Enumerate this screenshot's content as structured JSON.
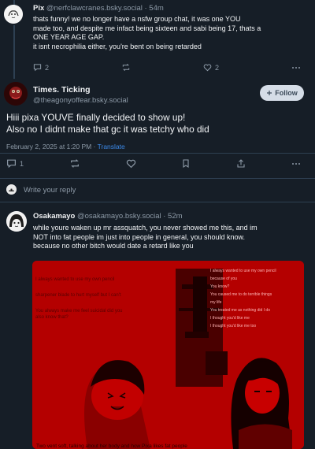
{
  "posts": {
    "pix": {
      "display_name": "Pix",
      "handle": "@nerfclawcranes.bsky.social",
      "time": "· 54m",
      "text_lines": [
        "thats funny! we no longer have a nsfw group chat, it was one YOU",
        "made too, and despite me infact being sixteen and sabi being 17, thats a",
        "ONE YEAR AGE GAP.",
        "it isnt necrophilia either, you're bent on being retarded"
      ],
      "reply_count": "2",
      "like_count": "2"
    },
    "times": {
      "display_name": "Times. Ticking",
      "handle": "@theagonyoffear.bsky.social",
      "follow_label": "Follow",
      "text_lines": [
        "Hiii pixa YOUVE finally decided to show up!",
        "Also no I didnt make that gc it was tetchy who did"
      ],
      "date": "February 2, 2025 at 1:20 PM",
      "translate_label": "Translate",
      "reply_count": "1"
    },
    "osakamayo": {
      "display_name": "Osakamayo",
      "handle": "@osakamayo.bsky.social",
      "time": "· 52m",
      "text_lines": [
        "while youre waken up mr assquatch, you never showed me this, and im",
        "NOT into fat people im just into people in general, you should know.",
        "because no other bitch would date a retard like you"
      ],
      "image": {
        "left_lines": [
          "I always wanted to use my own pencil",
          "sharpener blade to hurt myself but I can't",
          "You always make me feel suicidal did you",
          "also know that?"
        ],
        "right_lines": [
          "I always wanted to use my own pencil",
          "because of you",
          "You know?",
          "You caused me to do terrible things",
          "my life",
          "You treated me as nothing did I do",
          "I thought you'd like me",
          "I thought you'd like me too"
        ],
        "caption": "Two vent soft, talking about her body and how Pixa likes fat people"
      }
    }
  },
  "composer": {
    "placeholder": "Write your reply"
  },
  "colors": {
    "background": "#161e27",
    "muted": "#8d9aa7",
    "link": "#3b88e6",
    "divider": "#2e4052"
  }
}
